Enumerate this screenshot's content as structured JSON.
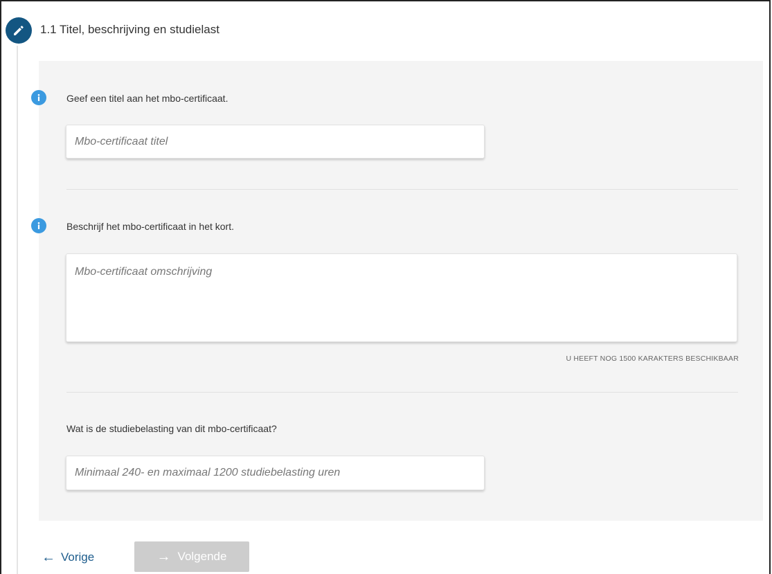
{
  "section": {
    "title": "1.1 Titel, beschrijving en studielast"
  },
  "fields": {
    "title": {
      "label": "Geef een titel aan het mbo-certificaat.",
      "placeholder": "Mbo-certificaat titel"
    },
    "description": {
      "label": "Beschrijf het mbo-certificaat in het kort.",
      "placeholder": "Mbo-certificaat omschrijving",
      "char_count": "U HEEFT NOG 1500 KARAKTERS BESCHIKBAAR"
    },
    "study_load": {
      "label": "Wat is de studiebelasting van dit mbo-certificaat?",
      "placeholder": "Minimaal 240- en maximaal 1200 studiebelasting uren"
    }
  },
  "navigation": {
    "prev_label": "Vorige",
    "next_label": "Volgende",
    "prev_arrow": "←",
    "next_arrow": "→"
  },
  "icons": {
    "step": "pencil-icon",
    "info": "info-icon"
  },
  "colors": {
    "step_icon_bg": "#135682",
    "info_icon_bg": "#3b9ae0",
    "prev_link": "#1d5c8c",
    "next_disabled_bg": "#cdcdcd",
    "panel_bg": "#f4f4f4"
  }
}
